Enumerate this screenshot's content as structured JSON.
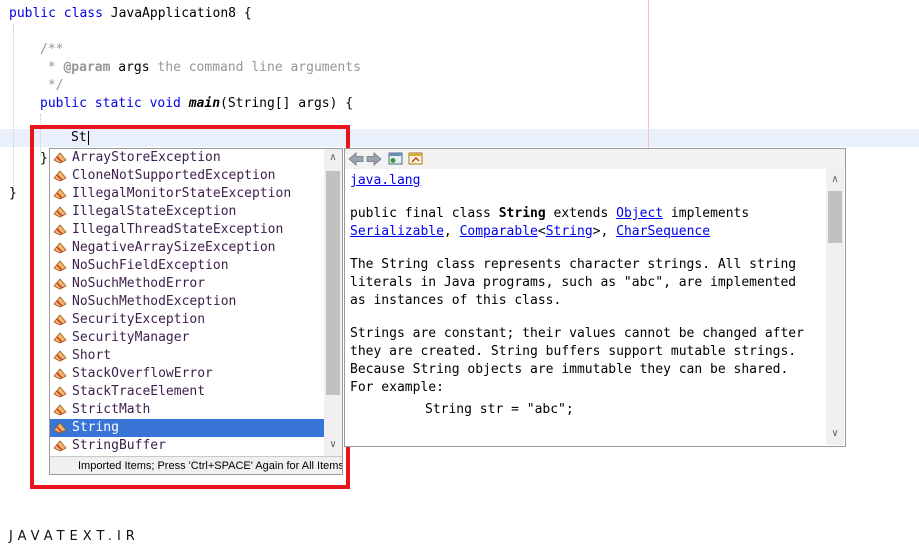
{
  "editor": {
    "class_decl": {
      "kw": "public class",
      "name": "JavaApplication8",
      "brace": "{"
    },
    "comment_open": "/**",
    "comment_param": {
      "star": " * ",
      "tag": "@param",
      "arg": "args",
      "desc": " the command line arguments"
    },
    "comment_close": " */",
    "method_decl": {
      "kw": "public static void",
      "name": "main",
      "params": "(String[] args) {"
    },
    "typed_text": "St",
    "method_close": "}",
    "class_close": "}"
  },
  "completion": {
    "items": [
      "ArrayStoreException",
      "CloneNotSupportedException",
      "IllegalMonitorStateException",
      "IllegalStateException",
      "IllegalThreadStateException",
      "NegativeArraySizeException",
      "NoSuchFieldException",
      "NoSuchMethodError",
      "NoSuchMethodException",
      "SecurityException",
      "SecurityManager",
      "Short",
      "StackOverflowError",
      "StackTraceElement",
      "StrictMath",
      "String",
      "StringBuffer"
    ],
    "selected": "String",
    "status": "Imported Items; Press 'Ctrl+SPACE' Again for All Items",
    "highlight_color": "#e8141c"
  },
  "javadoc": {
    "package": "java.lang",
    "sig": {
      "prefix": "public final class ",
      "name": "String",
      "extends": " extends ",
      "parent": "Object",
      "implements": " implements",
      "iface1": "Serializable",
      "sep1": ", ",
      "iface2": "Comparable",
      "lt": "<",
      "iface2_param": "String",
      "gt": ">, ",
      "iface3": "CharSequence"
    },
    "para1": "The String class represents character strings. All string literals in Java programs, such as \"abc\", are implemented as instances of this class.",
    "para2": "Strings are constant; their values cannot be changed after they are created. String buffers support mutable strings. Because String objects are immutable they can be shared. For example:",
    "code_example": "String str = \"abc\";"
  },
  "footer": "JAVATEXT.IR"
}
